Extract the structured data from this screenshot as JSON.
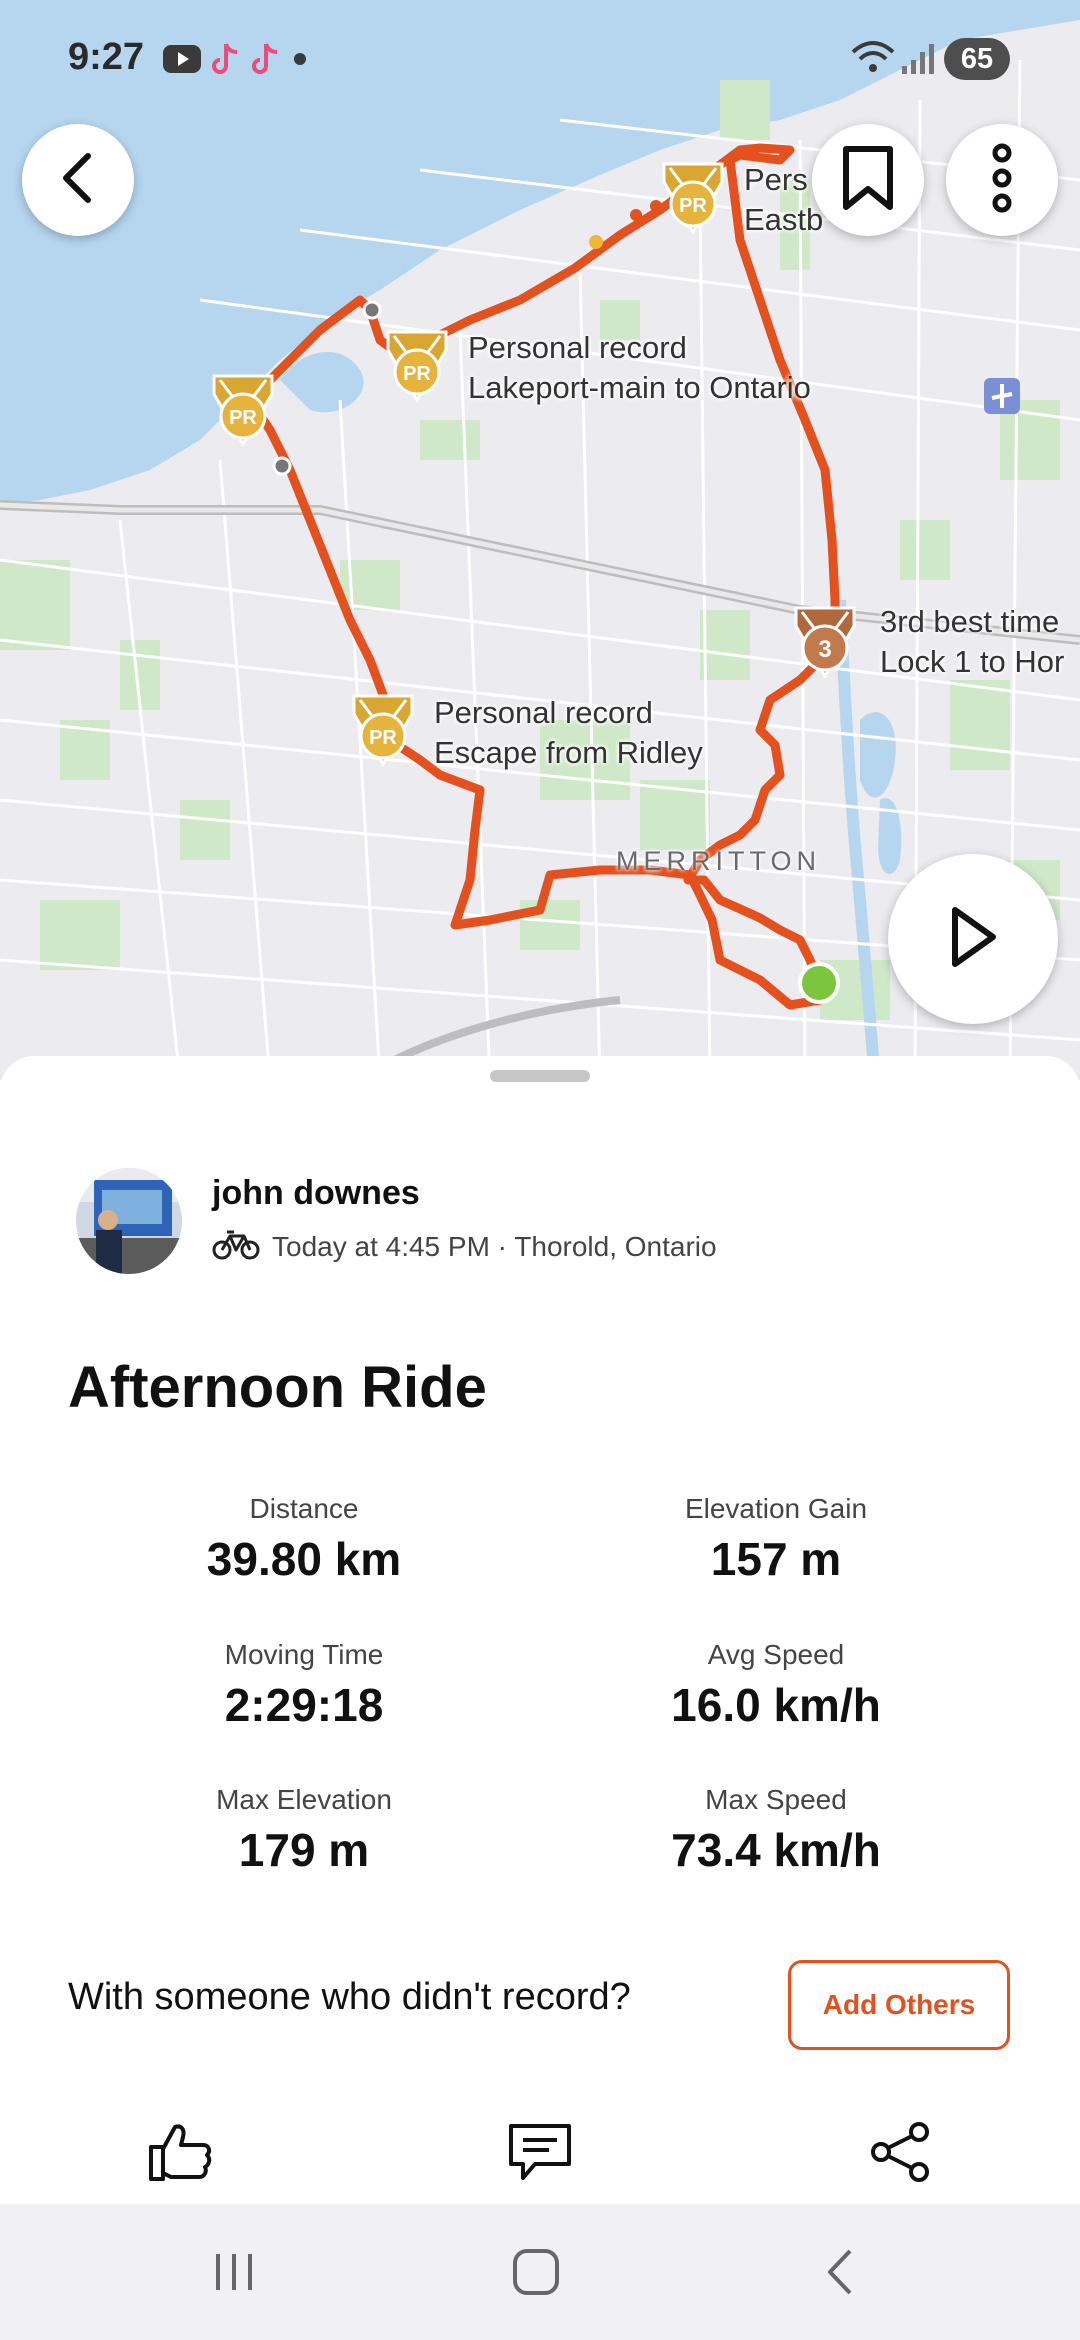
{
  "status_bar": {
    "time": "9:27",
    "battery": "65",
    "notification_icons": [
      "youtube-icon",
      "tiktok-icon",
      "tiktok-icon",
      "dot-icon"
    ]
  },
  "map": {
    "segments": [
      {
        "line1": "Personal record",
        "line2": "Lakeport-main to Ontario"
      },
      {
        "line1": "Personal record",
        "line2": "Escape from Ridley"
      },
      {
        "line1": "3rd best time",
        "line2": "Lock 1 to Hor"
      },
      {
        "line1": "Pers",
        "line2": "Eastb"
      }
    ],
    "pr_badge_text": "PR",
    "rank_badge_text": "3",
    "city": "MERRITTON",
    "route_color": "#e4511f"
  },
  "athlete": {
    "name": "john downes",
    "meta": "Today at 4:45 PM · Thorold, Ontario",
    "sport_icon": "bike-icon"
  },
  "activity": {
    "title": "Afternoon Ride"
  },
  "stats": [
    {
      "label": "Distance",
      "value": "39.80 km"
    },
    {
      "label": "Elevation Gain",
      "value": "157 m"
    },
    {
      "label": "Moving Time",
      "value": "2:29:18"
    },
    {
      "label": "Avg Speed",
      "value": "16.0 km/h"
    },
    {
      "label": "Max Elevation",
      "value": "179 m"
    },
    {
      "label": "Max Speed",
      "value": "73.4 km/h"
    }
  ],
  "others": {
    "prompt": "With someone who didn't record?",
    "button": "Add Others"
  },
  "colors": {
    "accent": "#e4511f",
    "pr_gold": "#d9a632",
    "bronze": "#b1683e",
    "start_green": "#7cc63e"
  }
}
